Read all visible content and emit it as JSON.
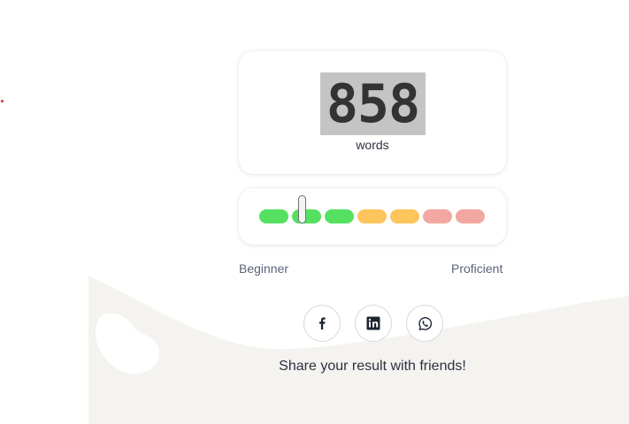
{
  "score": {
    "value": "858",
    "unit": "words"
  },
  "meter": {
    "segments": [
      {
        "level": "low",
        "color": "#56e061"
      },
      {
        "level": "low",
        "color": "#56e061"
      },
      {
        "level": "low",
        "color": "#56e061"
      },
      {
        "level": "mid",
        "color": "#fdc55c"
      },
      {
        "level": "mid",
        "color": "#fdc55c"
      },
      {
        "level": "high",
        "color": "#f2a8a2"
      },
      {
        "level": "high",
        "color": "#f2a8a2"
      }
    ],
    "position_fraction": 0.19,
    "min_label": "Beginner",
    "max_label": "Proficient"
  },
  "share": {
    "buttons": [
      {
        "name": "facebook-icon"
      },
      {
        "name": "linkedin-icon"
      },
      {
        "name": "whatsapp-icon"
      }
    ],
    "text": "Share your result with friends!"
  },
  "colors": {
    "background_wave": "#f4f3ef",
    "text": "#2d3142",
    "muted": "#5a6478"
  }
}
